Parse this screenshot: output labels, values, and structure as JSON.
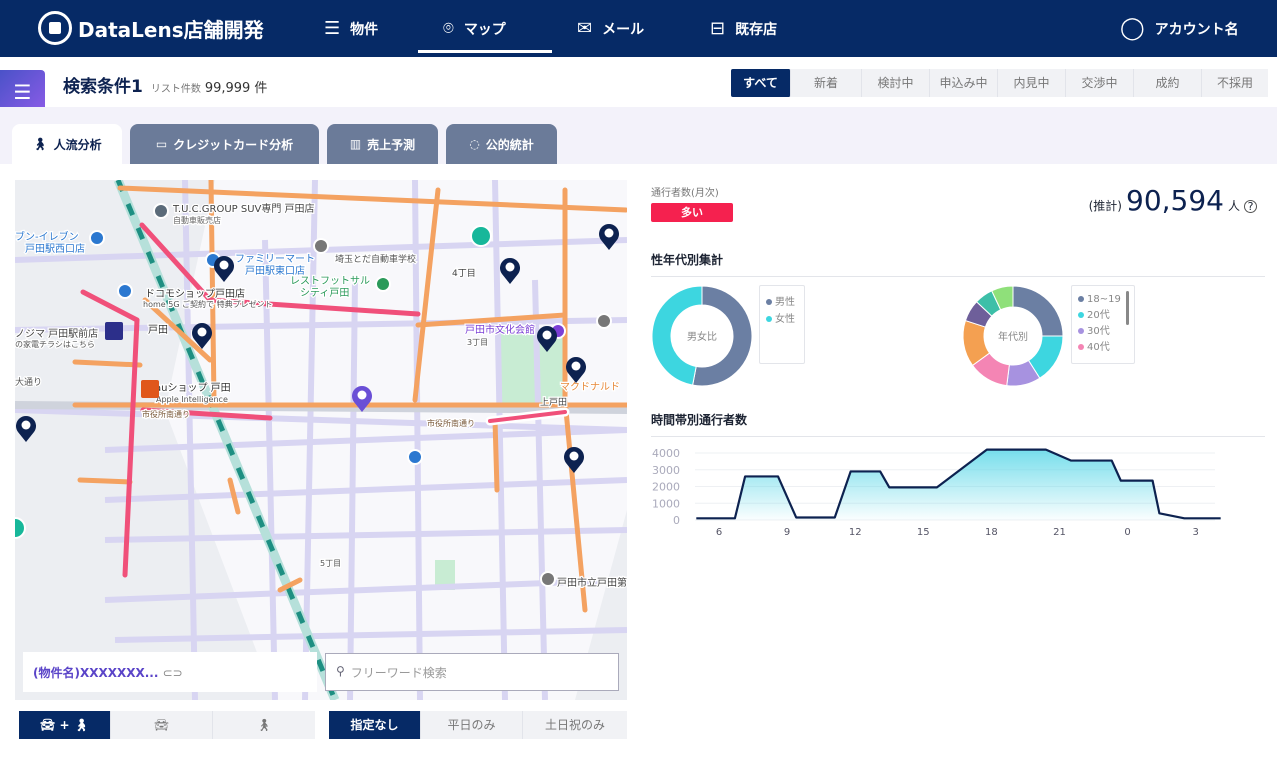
{
  "header": {
    "brand": "DataLens店舗開発",
    "nav": [
      {
        "label": "物件",
        "icon": "list-icon"
      },
      {
        "label": "マップ",
        "icon": "map-pin-icon",
        "active": true
      },
      {
        "label": "メール",
        "icon": "mail-icon"
      },
      {
        "label": "既存店",
        "icon": "store-check-icon"
      }
    ],
    "account": "アカウント名"
  },
  "search_condition": {
    "title": "検索条件1",
    "count_label": "リスト件数",
    "count": "99,999",
    "count_unit": "件"
  },
  "status_filters": [
    {
      "label": "すべて",
      "active": true
    },
    {
      "label": "新着"
    },
    {
      "label": "検討中"
    },
    {
      "label": "申込み中"
    },
    {
      "label": "内見中"
    },
    {
      "label": "交渉中"
    },
    {
      "label": "成約"
    },
    {
      "label": "不採用"
    }
  ],
  "tabs": [
    {
      "label": "人流分析",
      "icon": "walking-person-icon",
      "active": true
    },
    {
      "label": "クレジットカード分析",
      "icon": "credit-card-icon"
    },
    {
      "label": "売上予測",
      "icon": "bar-chart-icon"
    },
    {
      "label": "公的統計",
      "icon": "ring-chart-icon"
    }
  ],
  "map": {
    "labels": [
      "T.U.C.GROUP SUV専門 戸田店",
      "自動車販売店",
      "ブン-イレブン",
      "戸田駅西口店",
      "ファミリーマート",
      "戸田駅東口店",
      "埼玉とだ自動車学校",
      "レストフットサル",
      "シティ戸田",
      "4丁目",
      "ドコモショップ戸田店",
      "home 5G ご契約で 特典プレゼント",
      "ノジマ 戸田駅前店",
      "の家電チラシはこちら",
      "戸田",
      "auショップ 戸田",
      "Apple Intelligence",
      "戸田市文化会館",
      "マクドナルド",
      "上戸田",
      "市役所南通り",
      "市役所南通り",
      "3丁目",
      "5丁目",
      "戸田市立戸田第",
      "大通り"
    ],
    "colors": {
      "high": "#f0507a",
      "mid": "#f4a261",
      "pin": "#0d2250",
      "selected_pin": "#6a4fd6"
    }
  },
  "property": {
    "name": "(物件名)XXXXXXX...",
    "link_icon": "link-icon"
  },
  "search": {
    "placeholder": "フリーワード検索"
  },
  "mode_filters": [
    {
      "label": "+",
      "icon": "car-plus-walk-icon",
      "active": true
    },
    {
      "label": "",
      "icon": "car-icon"
    },
    {
      "label": "",
      "icon": "walk-icon"
    }
  ],
  "day_filters": [
    {
      "label": "指定なし",
      "active": true
    },
    {
      "label": "平日のみ"
    },
    {
      "label": "土日祝のみ"
    }
  ],
  "traffic": {
    "label": "通行者数(月次)",
    "level": "多い",
    "level_color": "#f5214f",
    "estimate_prefix": "(推計)",
    "value": "90,594",
    "unit": "人",
    "help_icon": "question-circle-icon"
  },
  "demographics": {
    "title": "性年代別集計"
  },
  "chart_data": [
    {
      "type": "pie",
      "title": "男女比",
      "categories": [
        "男性",
        "女性"
      ],
      "values": [
        53,
        47
      ],
      "colors": [
        "#6b7fa3",
        "#3dd6e0"
      ],
      "legend": "right"
    },
    {
      "type": "pie",
      "title": "年代別",
      "categories": [
        "18~19",
        "20代",
        "30代",
        "40代",
        "",
        "",
        "",
        ""
      ],
      "values": [
        25,
        16,
        11,
        13,
        15,
        7,
        6,
        7
      ],
      "colors": [
        "#6b7fa3",
        "#3dd6e0",
        "#a792e0",
        "#f485b4",
        "#f4a051",
        "#6e5f9a",
        "#3dbfa8",
        "#8fe07a"
      ],
      "legend": "right"
    },
    {
      "type": "area",
      "title": "時間帯別通行者数",
      "x_tick_labels": [
        "6",
        "9",
        "12",
        "15",
        "18",
        "21",
        "0",
        "3"
      ],
      "x_ticks": [
        6,
        9,
        12,
        15,
        18,
        21,
        24,
        27
      ],
      "y_ticks": [
        0,
        1000,
        2000,
        3000,
        4000
      ],
      "ylim": [
        0,
        4400
      ],
      "grid": true,
      "x": [
        5,
        6.7,
        7.15,
        8.6,
        9.4,
        11.1,
        11.8,
        13.1,
        13.5,
        15.6,
        17.8,
        20.4,
        21.5,
        23.3,
        23.7,
        25.1,
        25.4,
        26.5,
        28.1
      ],
      "y": [
        100,
        100,
        2600,
        2600,
        150,
        150,
        2900,
        2900,
        1950,
        1950,
        4200,
        4200,
        3550,
        3550,
        2350,
        2350,
        400,
        100,
        100
      ],
      "line_color": "#0d2250",
      "fill_color": "#5fd8e8"
    }
  ]
}
